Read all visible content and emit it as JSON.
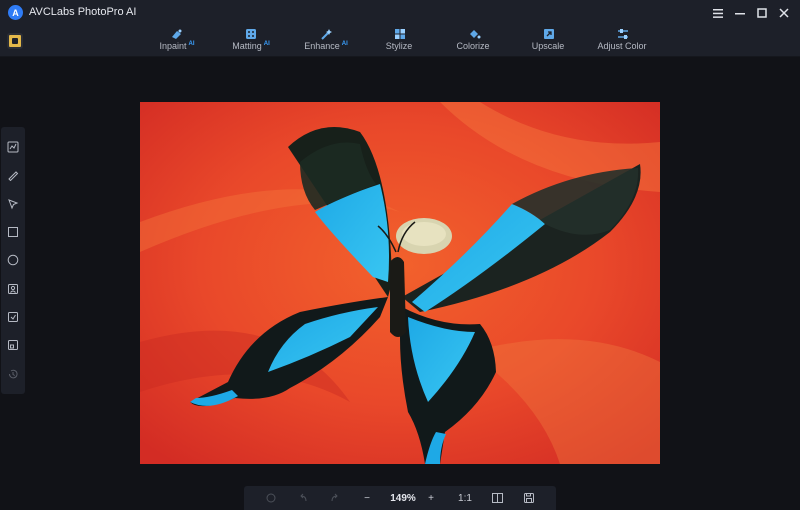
{
  "app": {
    "title": "AVCLabs PhotoPro AI",
    "logo_letter": "A"
  },
  "window_controls": [
    "menu-icon",
    "minimize-icon",
    "maximize-icon",
    "close-icon"
  ],
  "toolbar": {
    "tools": [
      {
        "label": "Inpaint",
        "ai": "AI",
        "icon": "inpaint-icon"
      },
      {
        "label": "Matting",
        "ai": "AI",
        "icon": "matting-icon"
      },
      {
        "label": "Enhance",
        "ai": "AI",
        "icon": "enhance-icon"
      },
      {
        "label": "Stylize",
        "ai": "",
        "icon": "stylize-icon"
      },
      {
        "label": "Colorize",
        "ai": "",
        "icon": "colorize-icon"
      },
      {
        "label": "Upscale",
        "ai": "",
        "icon": "upscale-icon"
      },
      {
        "label": "Adjust Color",
        "ai": "",
        "icon": "adjust-color-icon"
      }
    ]
  },
  "sidebar": {
    "items": [
      "auto-select-icon",
      "brush-icon",
      "lasso-icon",
      "rectangle-select-icon",
      "ellipse-select-icon",
      "portrait-select-icon",
      "object-select-icon",
      "image-select-icon",
      "history-icon"
    ]
  },
  "bottom": {
    "zoom": "149%",
    "ratio": "1:1",
    "minus": "−",
    "plus": "+"
  },
  "colors": {
    "background": "#111217",
    "panel": "#1d2029",
    "accent": "#3aa0ff",
    "home": "#e3b84a"
  }
}
